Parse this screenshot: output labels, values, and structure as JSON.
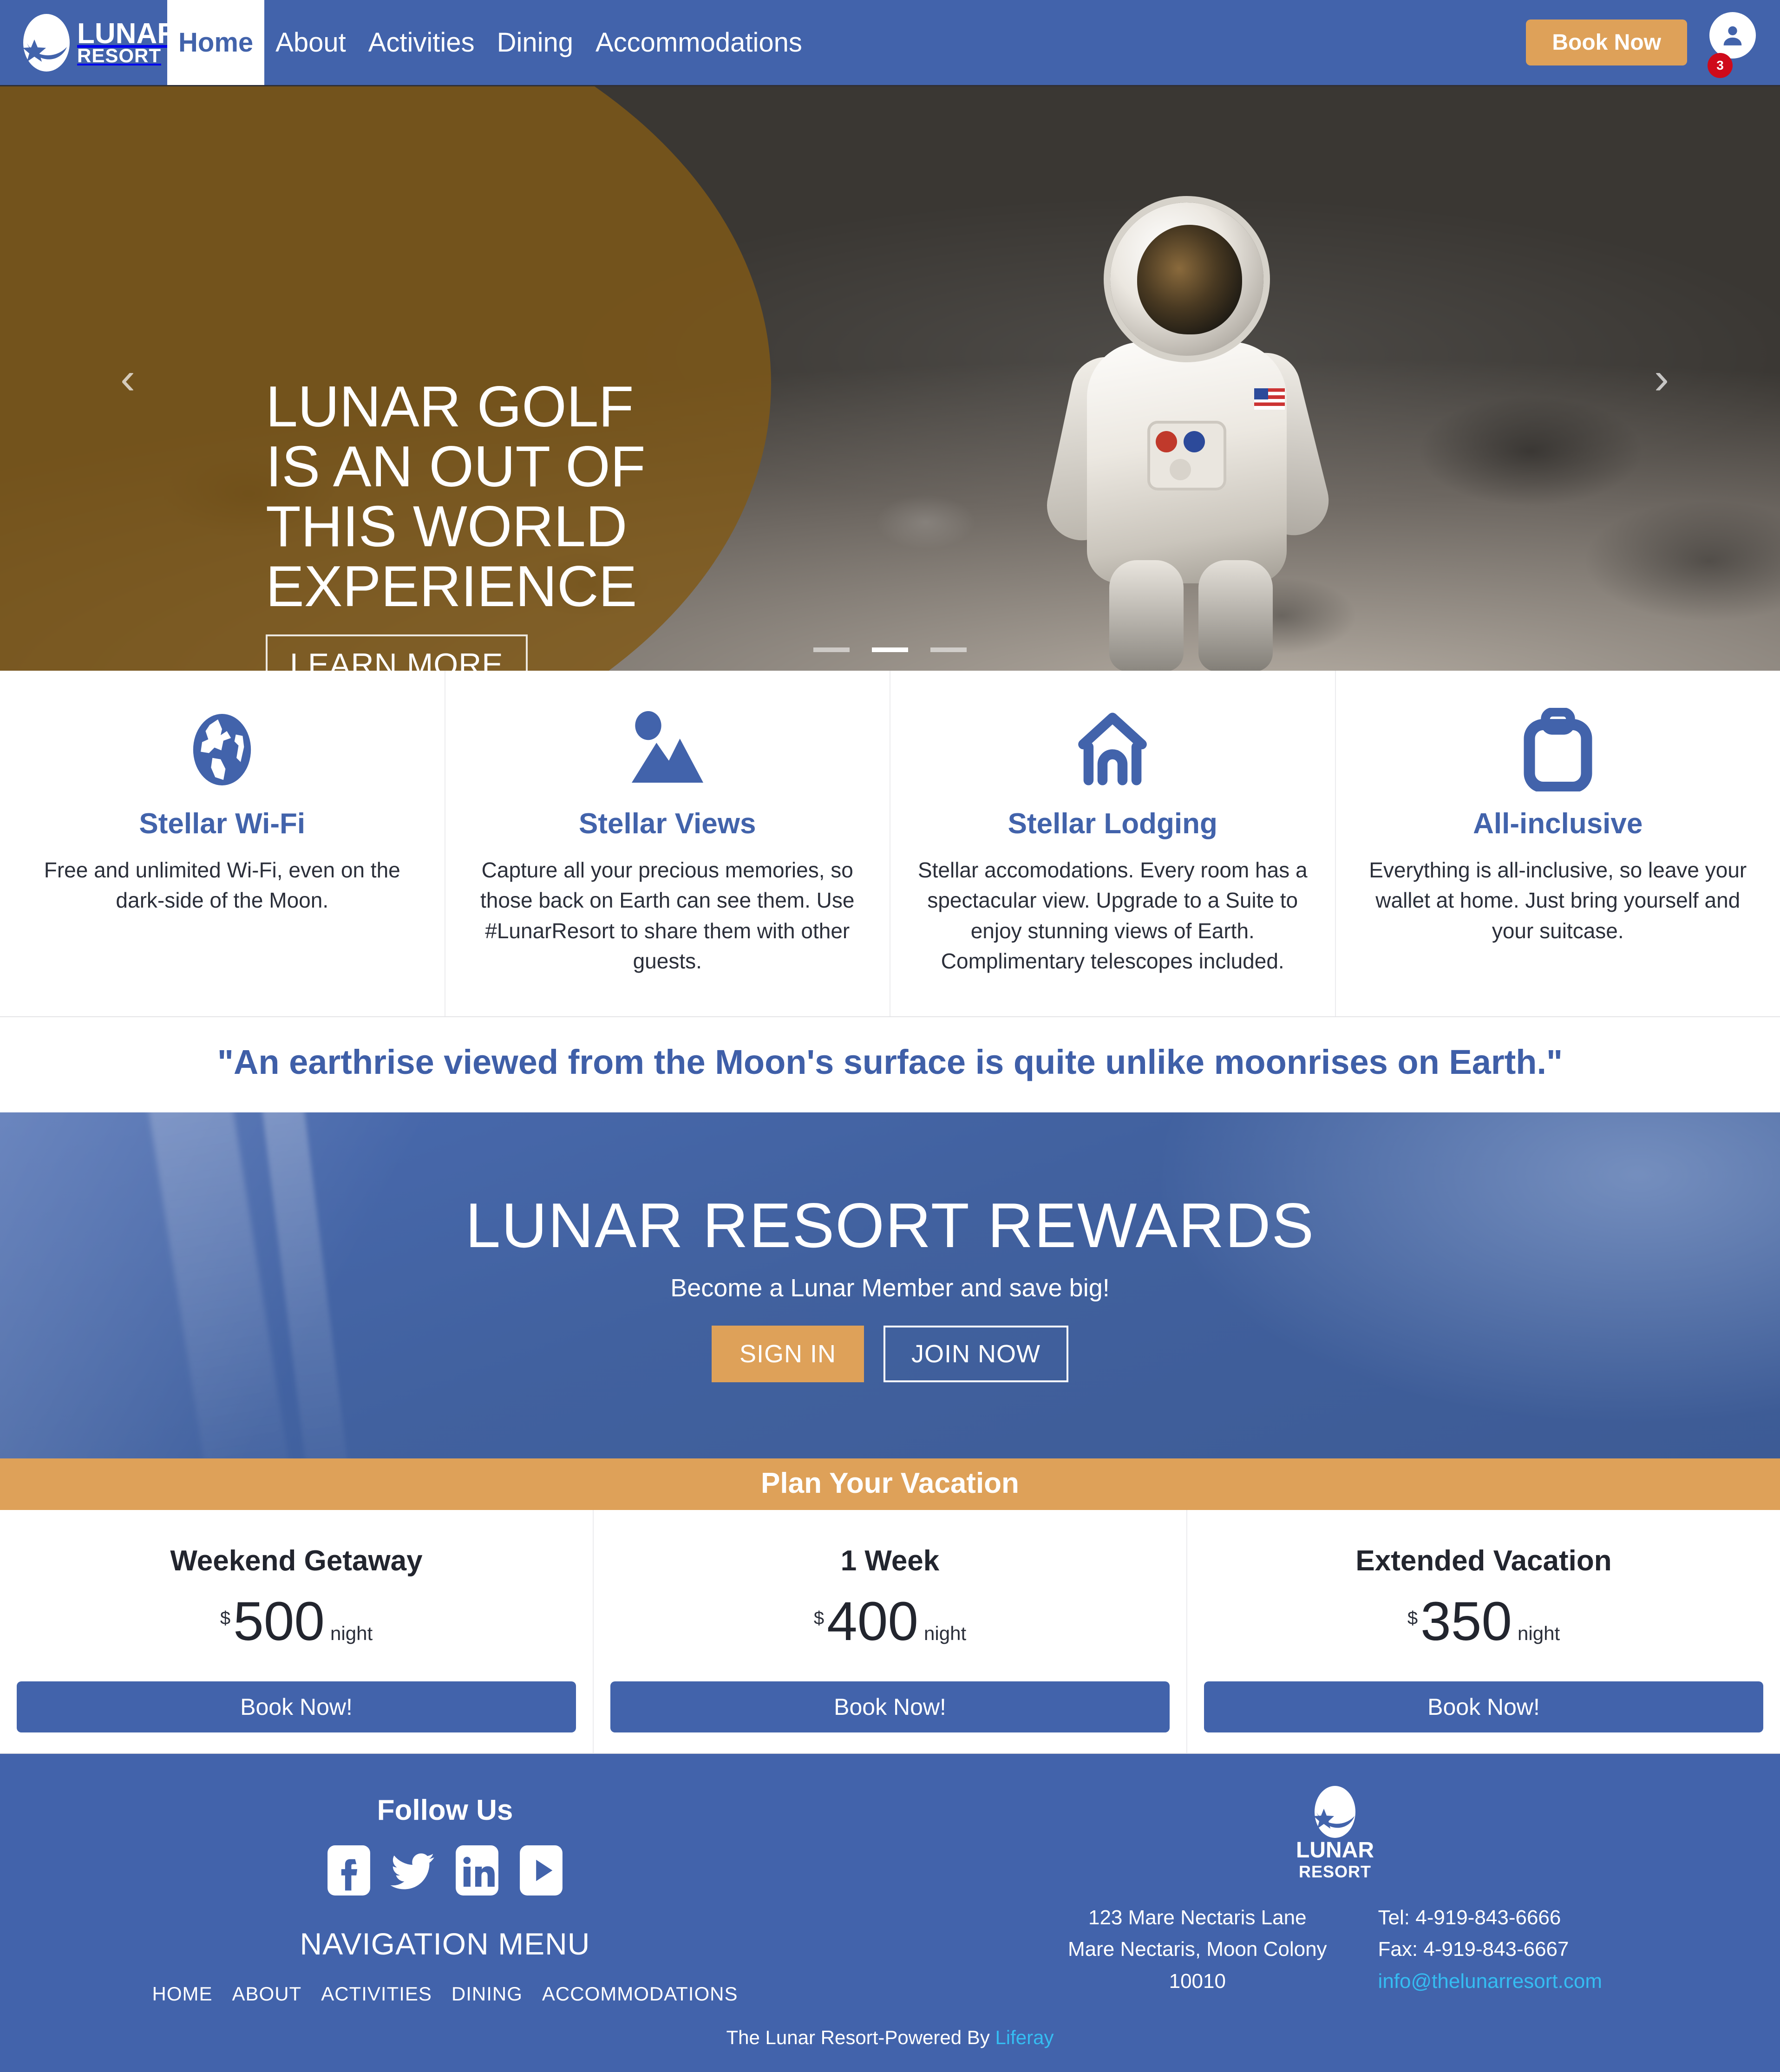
{
  "brand": {
    "name_line1": "LUNAR",
    "name_line2": "RESORT",
    "logo_icon": "moon-star-logo-icon"
  },
  "navbar": {
    "items": [
      {
        "label": "Home",
        "active": true
      },
      {
        "label": "About",
        "active": false
      },
      {
        "label": "Activities",
        "active": false
      },
      {
        "label": "Dining",
        "active": false
      },
      {
        "label": "Accommodations",
        "active": false
      }
    ],
    "book_now_label": "Book Now",
    "avatar_icon": "user-avatar-icon",
    "notification_count": "3",
    "background_color": "#4263ab",
    "accent_color": "#dea159",
    "badge_color": "#cf0a1a"
  },
  "hero": {
    "title_line1": "LUNAR GOLF",
    "title_line2": "IS AN OUT OF",
    "title_line3": "THIS WORLD",
    "title_line4": "EXPERIENCE",
    "cta_label": "LEARN MORE",
    "prev_icon": "chevron-left-icon",
    "next_icon": "chevron-right-icon",
    "indicators": [
      {
        "active": false
      },
      {
        "active": true
      },
      {
        "active": false
      }
    ],
    "overlay_color": "#805917"
  },
  "features": [
    {
      "icon": "globe-icon",
      "title": "Stellar Wi-Fi",
      "text": "Free and unlimited Wi-Fi, even on the dark-side of the Moon."
    },
    {
      "icon": "mountain-photo-icon",
      "title": "Stellar Views",
      "text": "Capture all your precious memories, so those back on Earth can see them. Use #LunarResort to share them with other guests."
    },
    {
      "icon": "house-icon",
      "title": "Stellar Lodging",
      "text": "Stellar accomodations. Every room has a spectacular view. Upgrade to a Suite to enjoy stunning views of Earth. Complimentary telescopes included."
    },
    {
      "icon": "suitcase-icon",
      "title": "All-inclusive",
      "text": "Everything is all-inclusive, so leave your wallet at home. Just bring yourself and your suitcase."
    }
  ],
  "quote": {
    "text": "\"An earthrise viewed from the Moon's surface is quite unlike moonrises on Earth.\"",
    "color": "#3f5fa8"
  },
  "rewards": {
    "title": "LUNAR RESORT REWARDS",
    "subtitle": "Become a Lunar Member and save big!",
    "sign_in_label": "SIGN IN",
    "join_now_label": "JOIN NOW"
  },
  "pricing": {
    "banner_label": "Plan Your Vacation",
    "banner_color": "#dea159",
    "plans": [
      {
        "title": "Weekend Getaway",
        "currency": "$",
        "amount": "500",
        "period": "night",
        "button_label": "Book Now!"
      },
      {
        "title": "1 Week",
        "currency": "$",
        "amount": "400",
        "period": "night",
        "button_label": "Book Now!"
      },
      {
        "title": "Extended Vacation",
        "currency": "$",
        "amount": "350",
        "period": "night",
        "button_label": "Book Now!"
      }
    ]
  },
  "footer": {
    "follow_title": "Follow Us",
    "social": [
      {
        "icon": "facebook-icon",
        "name": "Facebook"
      },
      {
        "icon": "twitter-icon",
        "name": "Twitter"
      },
      {
        "icon": "linkedin-icon",
        "name": "LinkedIn"
      },
      {
        "icon": "youtube-icon",
        "name": "YouTube"
      }
    ],
    "nav_menu_title": "NAVIGATION MENU",
    "nav_items": [
      {
        "label": "HOME"
      },
      {
        "label": "ABOUT"
      },
      {
        "label": "ACTIVITIES"
      },
      {
        "label": "DINING"
      },
      {
        "label": "ACCOMMODATIONS"
      }
    ],
    "address_line1": "123 Mare Nectaris Lane",
    "address_line2": "Mare Nectaris, Moon Colony",
    "address_line3": "10010",
    "tel": "Tel: 4-919-843-6666",
    "fax": "Fax: 4-919-843-6667",
    "email": "info@thelunarresort.com",
    "email_color": "#35bdf2",
    "bottom_text": "The Lunar Resort-Powered By ",
    "bottom_link": "Liferay"
  }
}
